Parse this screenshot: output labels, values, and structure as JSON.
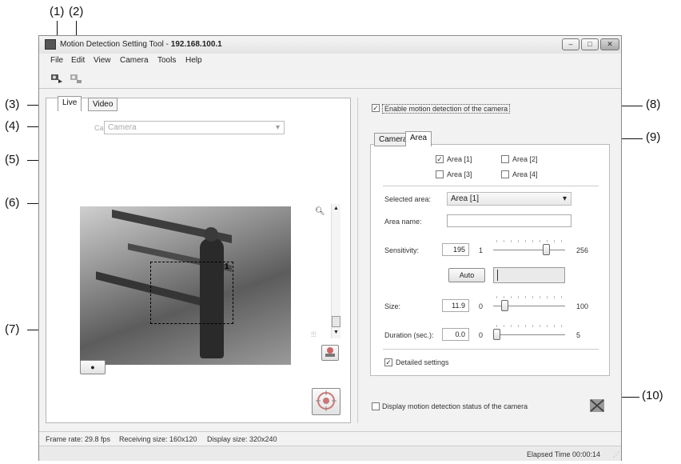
{
  "callouts": {
    "c1": "(1)",
    "c2": "(2)",
    "c3": "(3)",
    "c4": "(4)",
    "c5": "(5)",
    "c6": "(6)",
    "c7": "(7)",
    "c8": "(8)",
    "c9": "(9)",
    "c10": "(10)"
  },
  "window": {
    "title_prefix": "Motion Detection Setting Tool - ",
    "title_ip": "192.168.100.1",
    "minimize": "–",
    "maximize": "□",
    "close": "✕"
  },
  "menu": [
    "File",
    "Edit",
    "View",
    "Camera",
    "Tools",
    "Help"
  ],
  "toolbar": {
    "icon1": "camera-connect-icon",
    "icon2": "camera-disconnect-icon"
  },
  "left": {
    "tabs": [
      "Live",
      "Video"
    ],
    "camera_label": "Camera:",
    "camera_value": "Camera",
    "area_marker": "1",
    "record_button": "●"
  },
  "right": {
    "enable_motion": "Enable motion detection of the camera",
    "enable_checked": true,
    "tabs": [
      "Camera",
      "Area"
    ],
    "areas": [
      {
        "label": "Area [1]",
        "checked": true
      },
      {
        "label": "Area [2]",
        "checked": false
      },
      {
        "label": "Area [3]",
        "checked": false
      },
      {
        "label": "Area [4]",
        "checked": false
      }
    ],
    "selected_area_label": "Selected area:",
    "selected_area_value": "Area [1]",
    "area_name_label": "Area name:",
    "area_name_value": "",
    "sensitivity": {
      "label": "Sensitivity:",
      "value": "195",
      "min": "1",
      "max": "256",
      "level": 0.76
    },
    "auto_button": "Auto",
    "size": {
      "label": "Size:",
      "value": "11.9",
      "min": "0",
      "max": "100",
      "level": 0.119
    },
    "duration": {
      "label": "Duration (sec.):",
      "value": "0.0",
      "min": "0",
      "max": "5",
      "level": 0.0
    },
    "detailed_settings": "Detailed settings",
    "detailed_checked": true,
    "display_status": "Display motion detection status of the camera"
  },
  "status": {
    "frame_rate": "Frame rate: 29.8 fps",
    "receiving_size": "Receiving size: 160x120",
    "display_size": "Display size: 320x240",
    "elapsed": "Elapsed Time 00:00:14"
  }
}
